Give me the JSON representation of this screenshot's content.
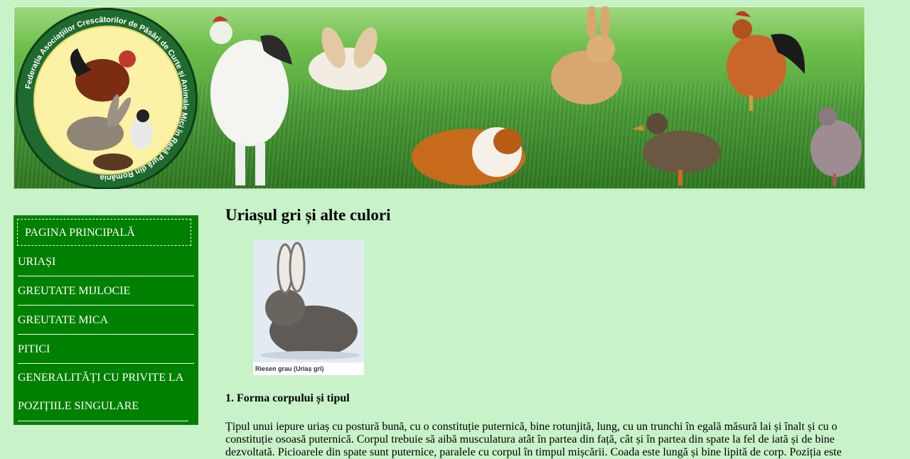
{
  "banner": {
    "logo_ring_text": "Federația Asociațiilor Crescătorilor de Păsări de Curte și Animale Mici în Rasă Pură din România",
    "logo_icon": "federation-logo-icon",
    "animals": [
      "rooster-icon",
      "rabbit-icon",
      "guinea-pig-icon",
      "duck-icon",
      "pigeon-icon"
    ]
  },
  "sidebar": {
    "home_label": "PAGINA PRINCIPALĂ",
    "items": [
      {
        "label": "URIAȘI"
      },
      {
        "label": "GREUTATE MIJLOCIE"
      },
      {
        "label": "GREUTATE MICA"
      },
      {
        "label": "PITICI"
      },
      {
        "label": "GENERALITĂȚI CU PRIVITE LA POZIȚIILE SINGULARE"
      }
    ]
  },
  "main": {
    "title": "Uriașul gri și alte culori",
    "photo_caption": "Riesen grau (Uriaș gri)",
    "section_heading": "1. Forma corpului și tipul",
    "paragraph": "Țipul unui iepure uriaș cu postură bună, cu o constituție puternică, bine rotunjită, lung, cu un trunchi în egală măsură lai și înalt și cu o constituție osoasă puternică. Corpul trebuie să aibă musculatura atât în partea din față, cât și în partea din spate la fel de iată și de bine dezvoltată. Picioarele din spate sunt puternice, paralele cu corpul în timpul mișcării. Coada este lungă și bine lipită de corp. Poziția este"
  },
  "colors": {
    "page_bg": "#c8f2c8",
    "nav_bg": "#008000",
    "nav_text": "#ffffff"
  }
}
